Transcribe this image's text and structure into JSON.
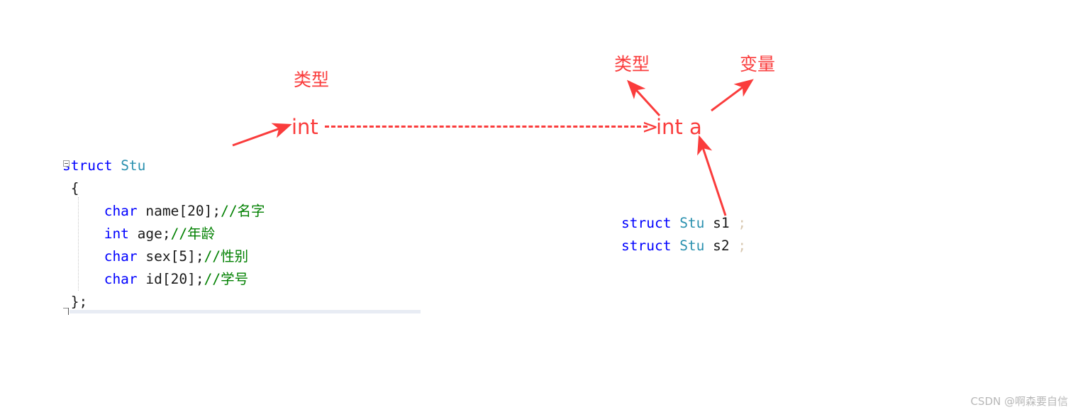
{
  "editor": {
    "code_lines": [
      [
        {
          "t": "struct ",
          "c": "kw"
        },
        {
          "t": "Stu",
          "c": "type-id"
        }
      ],
      [
        {
          "t": " {",
          "c": "plain"
        }
      ],
      [
        {
          "t": "     ",
          "c": "plain"
        },
        {
          "t": "char",
          "c": "kw"
        },
        {
          "t": " name[20];",
          "c": "plain"
        },
        {
          "t": "//名字",
          "c": "cmt"
        }
      ],
      [
        {
          "t": "     ",
          "c": "plain"
        },
        {
          "t": "int",
          "c": "kw"
        },
        {
          "t": " age;",
          "c": "plain"
        },
        {
          "t": "//年龄",
          "c": "cmt"
        }
      ],
      [
        {
          "t": "     ",
          "c": "plain"
        },
        {
          "t": "char",
          "c": "kw"
        },
        {
          "t": " sex[5];",
          "c": "plain"
        },
        {
          "t": "//性别",
          "c": "cmt"
        }
      ],
      [
        {
          "t": "     ",
          "c": "plain"
        },
        {
          "t": "char",
          "c": "kw"
        },
        {
          "t": " id[20];",
          "c": "plain"
        },
        {
          "t": "//学号",
          "c": "cmt"
        }
      ],
      [
        {
          "t": " };",
          "c": "plain"
        }
      ]
    ],
    "colors": {
      "keyword": "#0000ff",
      "type_identifier": "#2b91af",
      "plain": "#1a1a1a",
      "comment": "#008000",
      "current_line_bar": "#e8ecf4"
    }
  },
  "right_code": {
    "lines": [
      [
        {
          "t": "struct ",
          "c": "kw"
        },
        {
          "t": "Stu",
          "c": "type-id"
        },
        {
          "t": " s1",
          "c": "plain"
        },
        {
          "t": " ;",
          "c": "semi-faint"
        }
      ],
      [
        {
          "t": "struct ",
          "c": "kw"
        },
        {
          "t": "Stu",
          "c": "type-id"
        },
        {
          "t": " s2",
          "c": "plain"
        },
        {
          "t": " ;",
          "c": "semi-faint"
        }
      ]
    ]
  },
  "annotations": {
    "accent_color": "#fa3c3c",
    "label_left_type": "类型",
    "label_right_type": "类型",
    "label_right_variable": "变量",
    "text_int": "int",
    "text_int_a": "int  a",
    "arrowhead_gt": ">"
  },
  "watermark": {
    "text": "CSDN @啊森要自信"
  }
}
